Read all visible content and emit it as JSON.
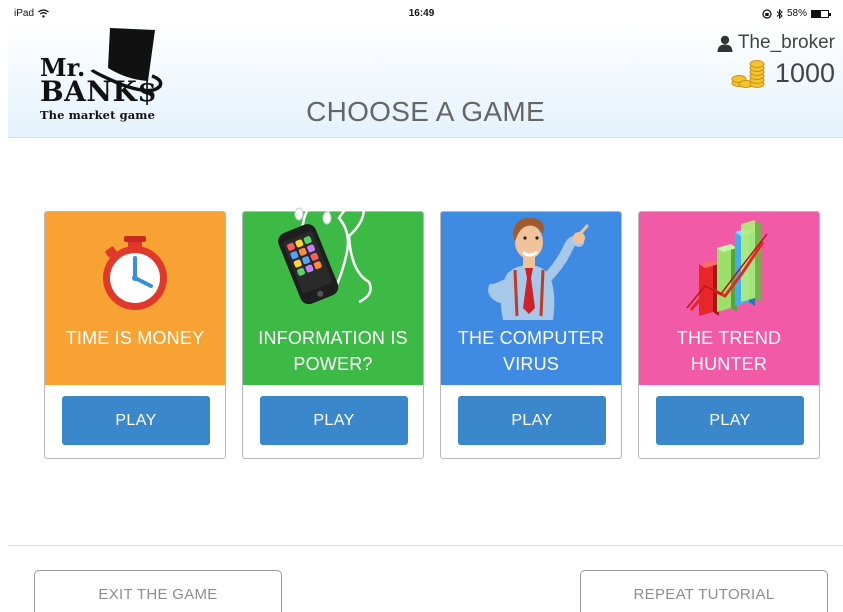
{
  "status_bar": {
    "device": "iPad",
    "time": "16:49",
    "battery_text": "58%",
    "battery_level": 0.58
  },
  "header": {
    "logo": {
      "line1": "Mr.",
      "line2": "BANK$",
      "tagline": "The market game"
    },
    "title": "CHOOSE A GAME",
    "username": "The_broker",
    "coins": "1000"
  },
  "games": [
    {
      "title_line1": "TIME IS MONEY",
      "title_line2": "",
      "play_label": "PLAY",
      "color": "#f7a233",
      "icon": "stopwatch-icon"
    },
    {
      "title_line1": "INFORMATION IS",
      "title_line2": "POWER?",
      "play_label": "PLAY",
      "color": "#3cba45",
      "icon": "smartphone-icon"
    },
    {
      "title_line1": "THE COMPUTER",
      "title_line2": "VIRUS",
      "play_label": "PLAY",
      "color": "#3f8be3",
      "icon": "businessman-icon"
    },
    {
      "title_line1": "THE TREND",
      "title_line2": "HUNTER",
      "play_label": "PLAY",
      "color": "#f25aa8",
      "icon": "bar-chart-trend-icon"
    }
  ],
  "footer": {
    "exit_label": "EXIT THE GAME",
    "tutorial_label": "REPEAT TUTORIAL"
  },
  "colors": {
    "play_button": "#3a87cc",
    "header_gradient_bottom": "#e4f2fc"
  }
}
